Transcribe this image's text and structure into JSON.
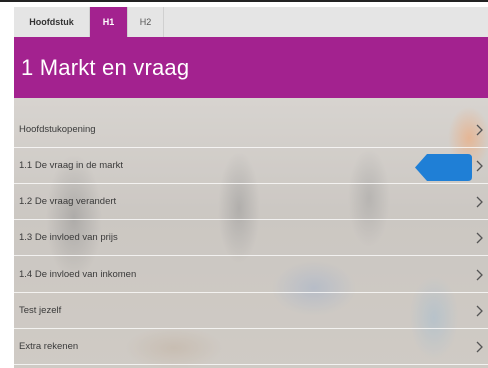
{
  "tabs": [
    {
      "label": "Hoofdstuk"
    },
    {
      "label": "H1"
    },
    {
      "label": "H2"
    }
  ],
  "chapter": {
    "title": "1 Markt en vraag"
  },
  "menu": {
    "items": [
      {
        "label": "Hoofdstukopening"
      },
      {
        "label": "1.1 De vraag in de markt"
      },
      {
        "label": "1.2 De vraag verandert"
      },
      {
        "label": "1.3 De invloed van prijs"
      },
      {
        "label": "1.4 De invloed van inkomen"
      },
      {
        "label": "Test jezelf"
      },
      {
        "label": "Extra rekenen"
      }
    ]
  },
  "colors": {
    "accent": "#a3228f",
    "marker": "#1f7fd6"
  },
  "icons": {
    "row_arrow": "chevron-right-icon",
    "current_marker": "current-position-marker"
  }
}
